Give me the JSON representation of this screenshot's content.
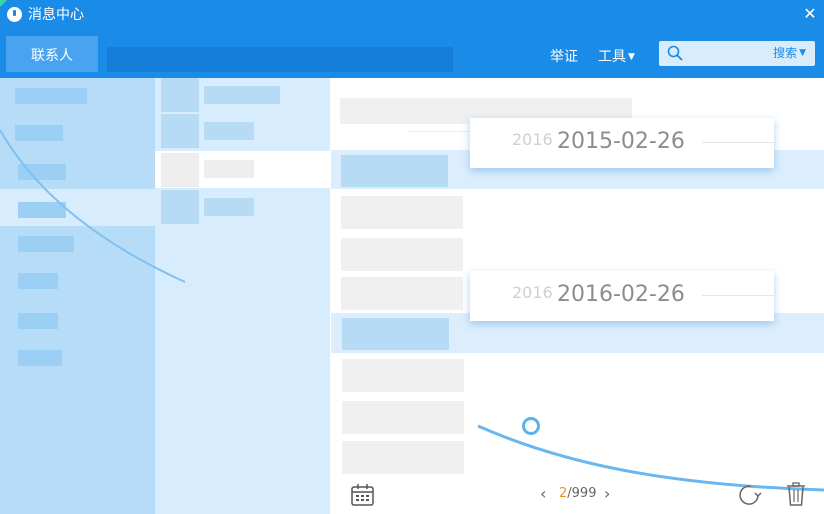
{
  "window": {
    "title": "消息中心",
    "close_glyph": "✕"
  },
  "toolbar": {
    "contacts_tab": "联系人",
    "report_label": "举证",
    "tools_label": "工具",
    "search_placeholder": "",
    "search_button": "搜索"
  },
  "date_popups": [
    {
      "ghost": "2016",
      "date": "2015-02-26"
    },
    {
      "ghost": "2016",
      "date": "2016-02-26"
    }
  ],
  "pager": {
    "current": "2",
    "separator_total": "/999",
    "prev_glyph": "‹",
    "next_glyph": "›"
  },
  "icons": {
    "app": "chat-bubble-icon",
    "search": "magnifier-icon",
    "calendar": "calendar-icon",
    "refresh": "refresh-icon",
    "trash": "trash-icon"
  },
  "colors": {
    "header": "#1b8be8",
    "accent_orange": "#f0932b",
    "sidebar": "#b6dcf8",
    "list_panel": "#d7ecfd"
  }
}
